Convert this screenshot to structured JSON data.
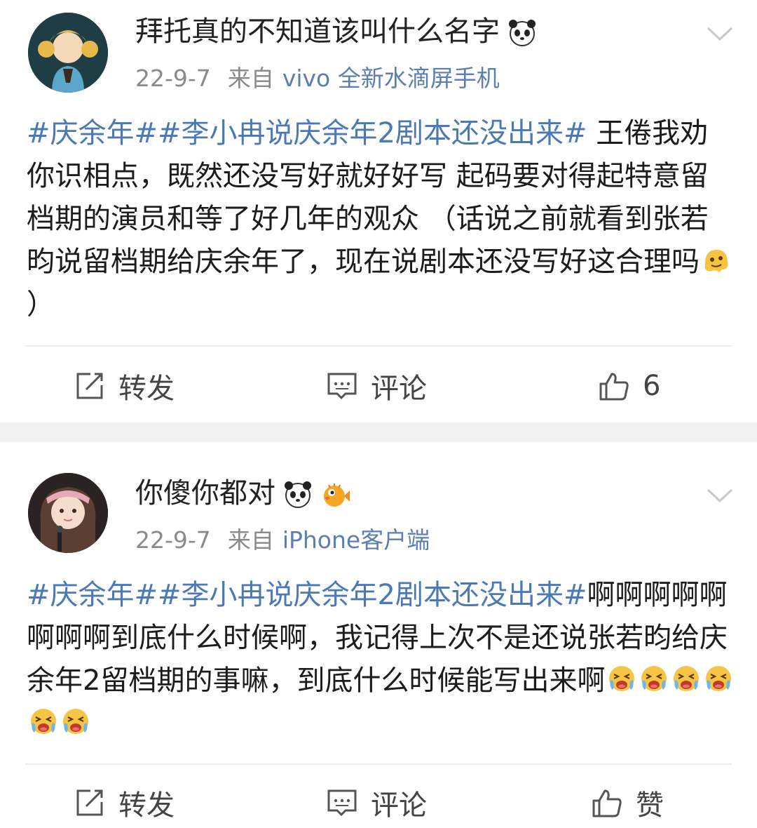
{
  "posts": [
    {
      "username": "拜托真的不知道该叫什么名字",
      "username_emojis": [
        "panda-emoji"
      ],
      "date": "22-9-7",
      "from_label": "来自",
      "source": "vivo 全新水滴屏手机",
      "body": {
        "tag": "#庆余年##李小冉说庆余年2剧本还没出来#",
        "text": " 王倦我劝你识相点，既然还没写好就好好写 起码要对得起特意留档期的演员和等了好几年的观众 （话说之前就看到张若昀说留档期给庆余年了，现在说剧本还没写好这合理吗",
        "emojis": [
          "melting-face-emoji"
        ],
        "tail": "）"
      },
      "actions": {
        "repost": "转发",
        "comment": "评论",
        "like": "6"
      }
    },
    {
      "username": "你傻你都对",
      "username_emojis": [
        "panda-emoji",
        "pufferfish-emoji"
      ],
      "date": "22-9-7",
      "from_label": "来自",
      "source": "iPhone客户端",
      "body": {
        "tag": "#庆余年##李小冉说庆余年2剧本还没出来#",
        "text": "啊啊啊啊啊啊啊啊到底什么时候啊，我记得上次不是还说张若昀给庆余年2留档期的事嘛，到底什么时候能写出来啊",
        "emojis": [
          "crying-face-emoji",
          "crying-face-emoji",
          "crying-face-emoji",
          "crying-face-emoji",
          "crying-face-emoji",
          "crying-face-emoji"
        ],
        "tail": ""
      },
      "actions": {
        "repost": "转发",
        "comment": "评论",
        "like": "赞"
      }
    }
  ],
  "colors": {
    "link": "#4a79b5",
    "meta": "#8a8a8a",
    "source": "#5b7fb3",
    "separator": "#f2f2f2"
  }
}
